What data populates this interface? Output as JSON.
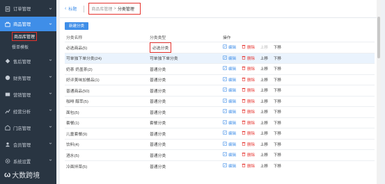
{
  "sidebar": {
    "items": [
      {
        "label": "订单管理",
        "icon": "order-icon"
      },
      {
        "label": "商品管理",
        "icon": "goods-icon",
        "active": true
      },
      {
        "label": "售后管理",
        "icon": "aftersale-icon"
      },
      {
        "label": "财务管理",
        "icon": "finance-icon"
      },
      {
        "label": "营销管理",
        "icon": "marketing-icon"
      },
      {
        "label": "经营分析",
        "icon": "analysis-icon"
      },
      {
        "label": "门店管理",
        "icon": "store-icon"
      },
      {
        "label": "会员管理",
        "icon": "member-icon"
      },
      {
        "label": "系统设置",
        "icon": "settings-icon"
      }
    ],
    "sub_items": [
      {
        "label": "商品库管理",
        "active": true
      },
      {
        "label": "餐单模板"
      }
    ]
  },
  "header": {
    "back_label": "标题",
    "crumb_parent": "商品库管理",
    "crumb_sep": ">",
    "crumb_current": "分类管理"
  },
  "toolbar": {
    "new_label": "新建分类"
  },
  "table": {
    "headers": [
      "分类名称",
      "分类类型",
      "操作"
    ],
    "actions": {
      "edit": "编辑",
      "delete": "删除",
      "up": "上移",
      "down": "下移"
    },
    "rows": [
      {
        "name": "必选商品(5)",
        "type": "必选分类",
        "boxed": true,
        "up_disabled": true
      },
      {
        "name": "可单独下单分类(24)",
        "type": "可单独下单分类",
        "highlight": true
      },
      {
        "name": "奶茶 奶盖茶(2)",
        "type": "普通分类"
      },
      {
        "name": "好评美味加餐品(1)",
        "type": "普通分类"
      },
      {
        "name": "普通商品(50)",
        "type": "普通分类"
      },
      {
        "name": "咖啡 醇萃(5)",
        "type": "普通分类"
      },
      {
        "name": "面包(5)",
        "type": "普通分类"
      },
      {
        "name": "套餐(1)",
        "type": "套餐分类"
      },
      {
        "name": "儿童套餐(9)",
        "type": "普通分类"
      },
      {
        "name": "饮料(4)",
        "type": "普通分类"
      },
      {
        "name": "酒水(5)",
        "type": "普通分类"
      },
      {
        "name": "冷面拌菜(5)",
        "type": "普通分类"
      }
    ]
  },
  "watermark": {
    "text": "大数跨境",
    "logo": "ω"
  },
  "colors": {
    "accent": "#3f8ee8",
    "danger": "#e5322d",
    "sidebar": "#293542"
  }
}
